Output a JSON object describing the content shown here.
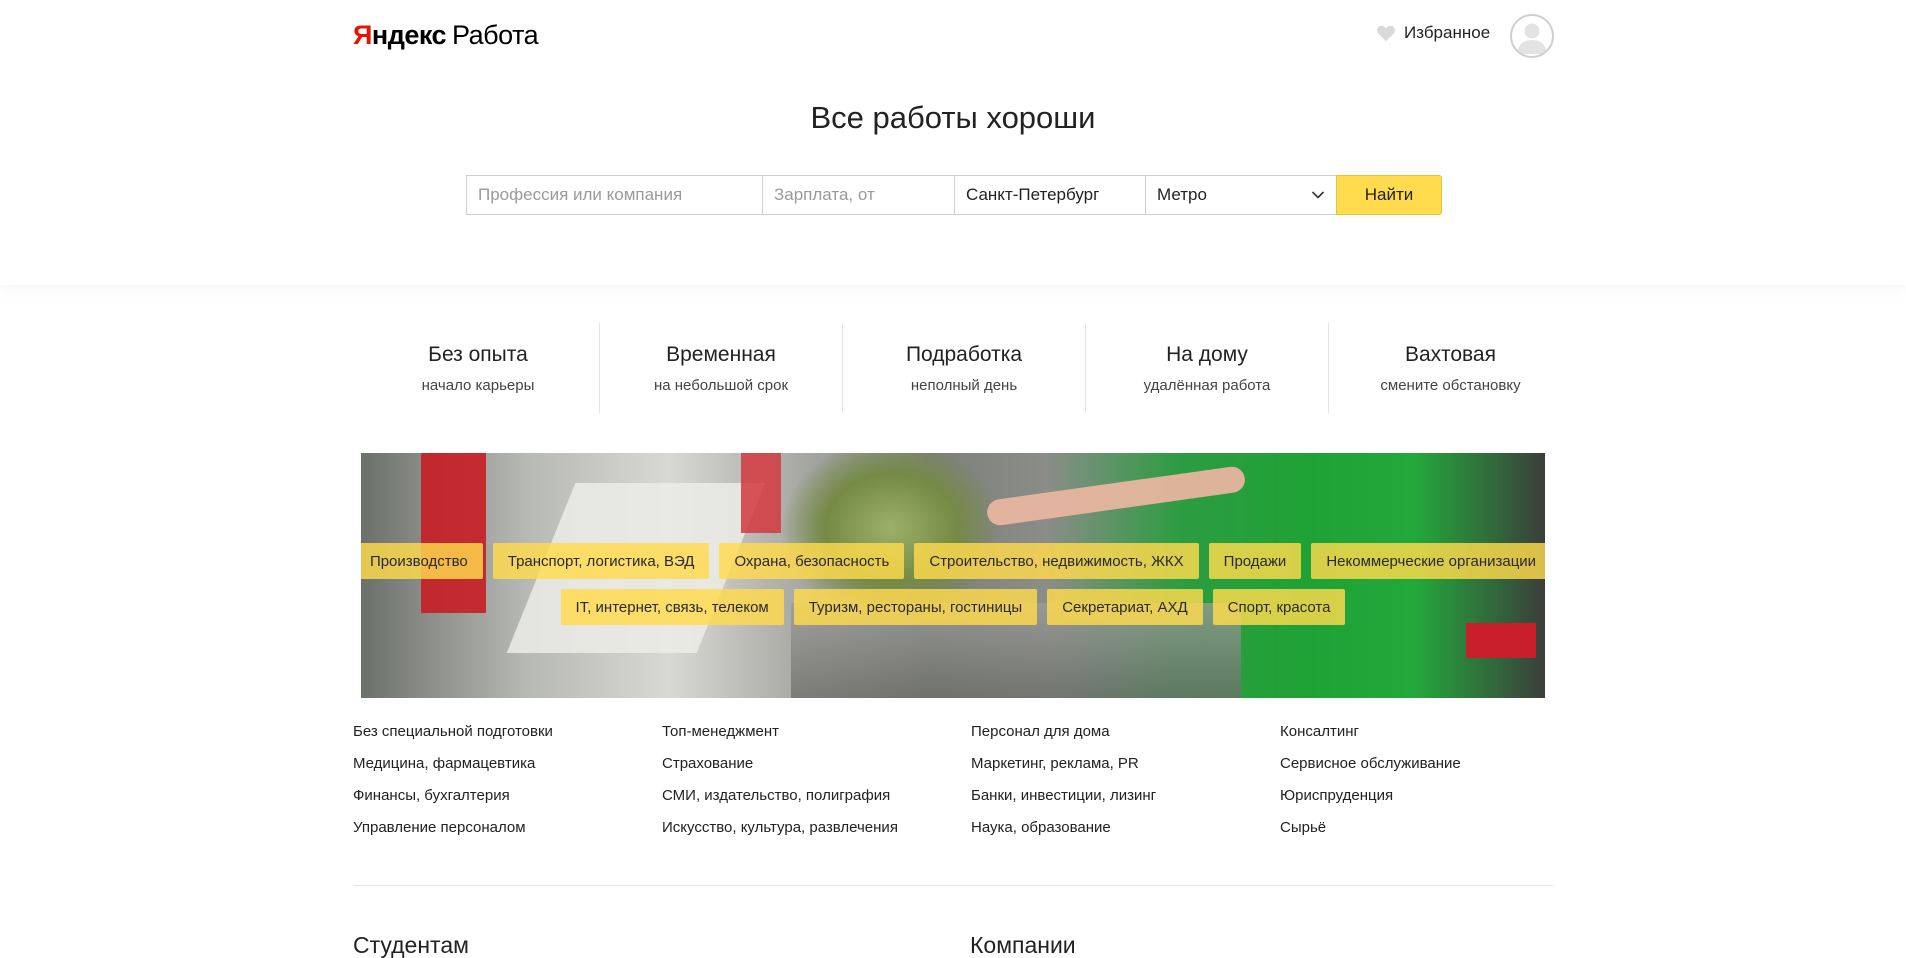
{
  "header": {
    "logo_brand_first": "Я",
    "logo_brand_rest": "ндекс",
    "logo_service": "Работа",
    "favorites_label": "Избранное"
  },
  "hero": {
    "headline": "Все работы хороши"
  },
  "search": {
    "profession_placeholder": "Профессия или компания",
    "salary_placeholder": "Зарплата, от",
    "city_value": "Санкт-Петербург",
    "metro_value": "Метро",
    "submit_label": "Найти"
  },
  "job_types": [
    {
      "title": "Без опыта",
      "subtitle": "начало карьеры"
    },
    {
      "title": "Временная",
      "subtitle": "на небольшой срок"
    },
    {
      "title": "Подработка",
      "subtitle": "неполный день"
    },
    {
      "title": "На дому",
      "subtitle": "удалённая работа"
    },
    {
      "title": "Вахтовая",
      "subtitle": "смените обстановку"
    }
  ],
  "banner_tags": {
    "row1": [
      "Производство",
      "Транспорт, логистика, ВЭД",
      "Охрана, безопасность",
      "Строительство, недвижимость, ЖКХ",
      "Продажи",
      "Некоммерческие организации"
    ],
    "row2": [
      "IT, интернет, связь, телеком",
      "Туризм, рестораны, гостиницы",
      "Секретариат, АХД",
      "Спорт, красота"
    ]
  },
  "categories": [
    [
      "Без специальной подготовки",
      "Медицина, фармацевтика",
      "Финансы, бухгалтерия",
      "Управление персоналом"
    ],
    [
      "Топ-менеджмент",
      "Страхование",
      "СМИ, издательство, полиграфия",
      "Искусство, культура, развлечения"
    ],
    [
      "Персонал для дома",
      "Маркетинг, реклама, PR",
      "Банки, инвестиции, лизинг",
      "Наука, образование"
    ],
    [
      "Консалтинг",
      "Сервисное обслуживание",
      "Юриспруденция",
      "Сырьё"
    ]
  ],
  "sections": {
    "students": "Студентам",
    "companies": "Компании"
  },
  "colors": {
    "accent_yellow": "#ffdb4d",
    "brand_red": "#e61400"
  }
}
